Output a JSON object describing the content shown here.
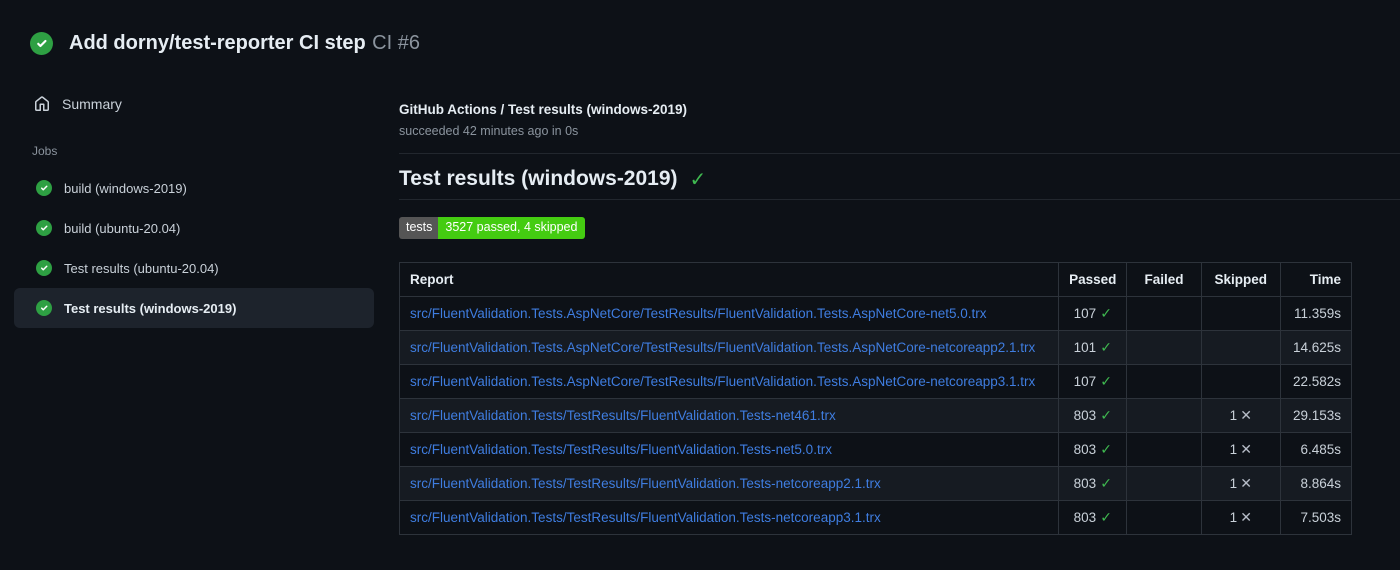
{
  "run_header": {
    "title": "Add dorny/test-reporter CI step",
    "run_number": "CI #6",
    "status": "success"
  },
  "sidebar": {
    "summary_label": "Summary",
    "jobs_label": "Jobs",
    "jobs": [
      {
        "label": "build (windows-2019)",
        "status": "success",
        "selected": false
      },
      {
        "label": "build (ubuntu-20.04)",
        "status": "success",
        "selected": false
      },
      {
        "label": "Test results (ubuntu-20.04)",
        "status": "success",
        "selected": false
      },
      {
        "label": "Test results (windows-2019)",
        "status": "success",
        "selected": true
      }
    ]
  },
  "main": {
    "sub_title": "GitHub Actions / Test results (windows-2019)",
    "sub_status": "succeeded 42 minutes ago in 0s",
    "heading": "Test results (windows-2019)",
    "badge": {
      "label": "tests",
      "value": "3527 passed, 4 skipped"
    }
  },
  "table": {
    "headers": [
      "Report",
      "Passed",
      "Failed",
      "Skipped",
      "Time"
    ],
    "rows": [
      {
        "report": "src/FluentValidation.Tests.AspNetCore/TestResults/FluentValidation.Tests.AspNetCore-net5.0.trx",
        "passed": "107",
        "failed": "",
        "skipped": "",
        "time": "11.359s"
      },
      {
        "report": "src/FluentValidation.Tests.AspNetCore/TestResults/FluentValidation.Tests.AspNetCore-netcoreapp2.1.trx",
        "passed": "101",
        "failed": "",
        "skipped": "",
        "time": "14.625s"
      },
      {
        "report": "src/FluentValidation.Tests.AspNetCore/TestResults/FluentValidation.Tests.AspNetCore-netcoreapp3.1.trx",
        "passed": "107",
        "failed": "",
        "skipped": "",
        "time": "22.582s"
      },
      {
        "report": "src/FluentValidation.Tests/TestResults/FluentValidation.Tests-net461.trx",
        "passed": "803",
        "failed": "",
        "skipped": "1",
        "time": "29.153s"
      },
      {
        "report": "src/FluentValidation.Tests/TestResults/FluentValidation.Tests-net5.0.trx",
        "passed": "803",
        "failed": "",
        "skipped": "1",
        "time": "6.485s"
      },
      {
        "report": "src/FluentValidation.Tests/TestResults/FluentValidation.Tests-netcoreapp2.1.trx",
        "passed": "803",
        "failed": "",
        "skipped": "1",
        "time": "8.864s"
      },
      {
        "report": "src/FluentValidation.Tests/TestResults/FluentValidation.Tests-netcoreapp3.1.trx",
        "passed": "803",
        "failed": "",
        "skipped": "1",
        "time": "7.503s"
      }
    ]
  },
  "colors": {
    "success_green": "#2ea043",
    "check_green": "#3fb950",
    "badge_label_bg": "#555555",
    "badge_value_bg": "#44cc11",
    "link_blue": "#3f7de0"
  }
}
